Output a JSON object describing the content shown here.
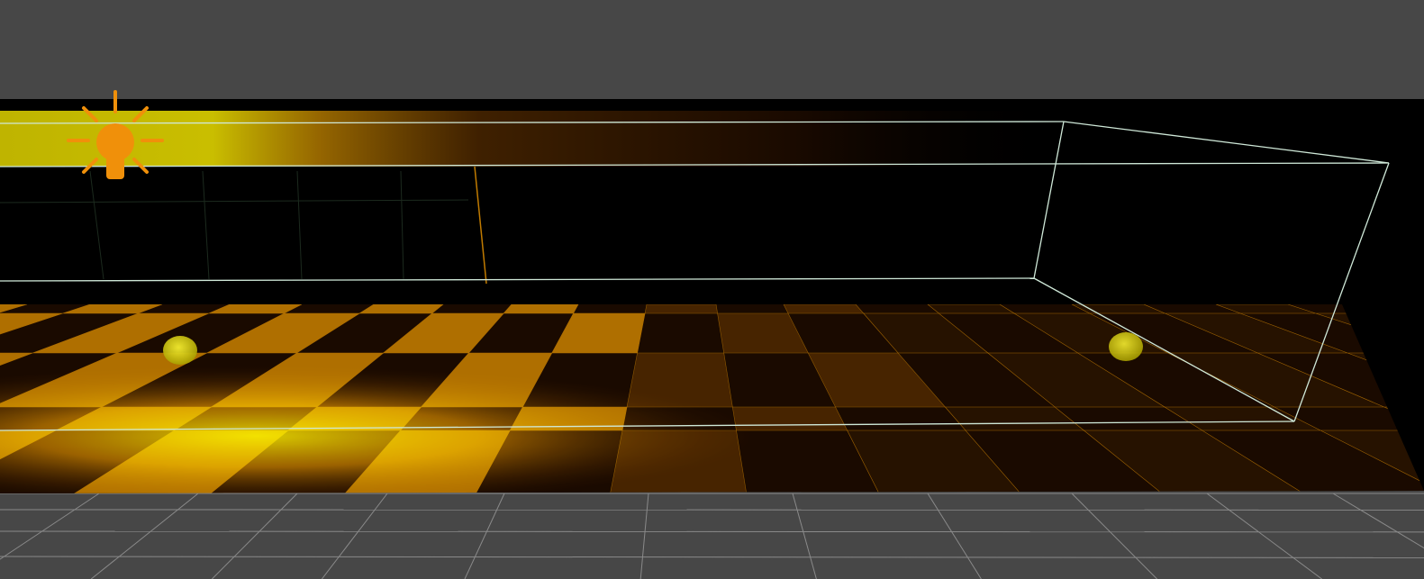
{
  "viewport": {
    "background_color": "#474747",
    "scene_background_color": "#000000",
    "grid_line_color": "#8a8a8a",
    "floor_tile_color_bright": "#d4c800",
    "floor_tile_color_mid": "#c07a00",
    "floor_tile_color_dark": "#1a0a00",
    "bounds_edge_color": "#cfe8d8",
    "light_icon_color": "#f0900a",
    "light_probe_color": "#c8c000",
    "scene_objects": [
      {
        "name": "point-light-gizmo",
        "icon": "lightbulb-icon"
      },
      {
        "name": "light-probe-left",
        "icon": "sphere-icon"
      },
      {
        "name": "light-probe-right",
        "icon": "sphere-icon"
      },
      {
        "name": "reflection-probe-bounds",
        "icon": "box-wireframe-icon"
      }
    ]
  }
}
